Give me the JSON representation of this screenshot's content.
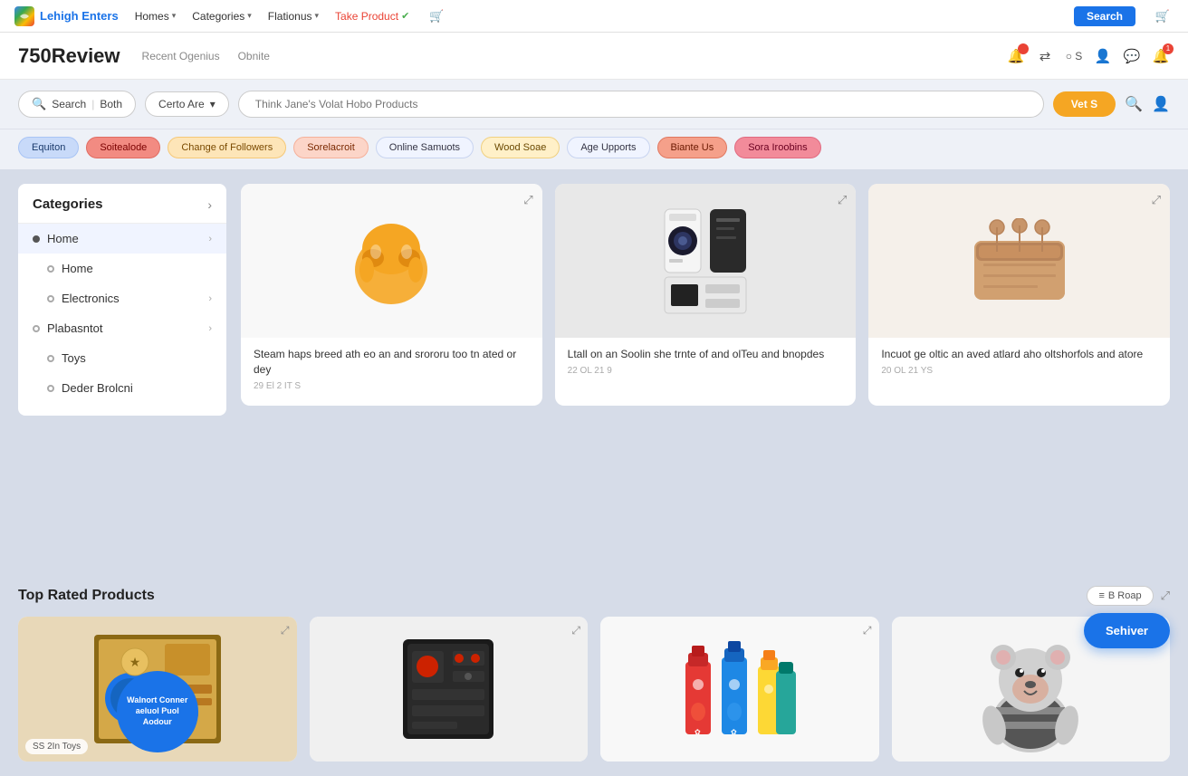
{
  "topNav": {
    "logoText": "Lehigh Enters",
    "items": [
      {
        "label": "Homes",
        "hasChevron": true
      },
      {
        "label": "Categories",
        "hasChevron": true
      },
      {
        "label": "Flationus",
        "hasChevron": true
      },
      {
        "label": "Take Product",
        "hasChevron": false,
        "highlight": true
      }
    ],
    "searchBtnLabel": "Search",
    "cartIcon": "🛒"
  },
  "secHeader": {
    "brandName": "750Review",
    "navLinks": [
      "Recent Ogenius",
      "Obnite"
    ],
    "icons": [
      "🔔",
      "🔀",
      "○S",
      "👤",
      "💬",
      "🔔"
    ]
  },
  "searchSection": {
    "searchPillLabel": "Search",
    "searchPillSub": "Both",
    "dropdownLabel": "Certo Are",
    "inputPlaceholder": "Think Jane's Volat Hobo Products",
    "actionBtnLabel": "Vet S",
    "icons": [
      "🔍",
      "👤"
    ]
  },
  "filterChips": [
    {
      "label": "Equiton",
      "style": "chip-blue"
    },
    {
      "label": "Soitealode",
      "style": "chip-red"
    },
    {
      "label": "Change of Followers",
      "style": "chip-orange"
    },
    {
      "label": "Sorelacroit",
      "style": "chip-peach"
    },
    {
      "label": "Online Samuots",
      "style": "chip-white"
    },
    {
      "label": "Wood Soae",
      "style": "chip-yellow"
    },
    {
      "label": "Age Upports",
      "style": "chip-white"
    },
    {
      "label": "Biante Us",
      "style": "chip-salmon"
    },
    {
      "label": "Sora Iroobins",
      "style": "chip-pink"
    }
  ],
  "sidebar": {
    "title": "Categories",
    "items": [
      {
        "label": "Home",
        "level": 0,
        "hasChevron": true,
        "active": true
      },
      {
        "label": "Home",
        "level": 1,
        "hasChevron": false
      },
      {
        "label": "Electronics",
        "level": 1,
        "hasChevron": true
      },
      {
        "label": "Plabasntot",
        "level": 0,
        "hasChevron": true
      },
      {
        "label": "Toys",
        "level": 1,
        "hasChevron": false
      },
      {
        "label": "Deder Brolcni",
        "level": 1,
        "hasChevron": false
      }
    ]
  },
  "productGrid": {
    "items": [
      {
        "title": "Steam haps breed ath eo an and srororu too tn ated or dey",
        "date": "29 El 2 IT S",
        "imgType": "orange-blob"
      },
      {
        "title": "Ltall on an Soolin she trnte of and olTeu and bnopdes",
        "date": "22 OL 21 9",
        "imgType": "black-device"
      },
      {
        "title": "Incuot ge oltic an aved atlard aho oltshorfols and atore",
        "date": "20 OL 21 YS",
        "imgType": "gold-box"
      }
    ]
  },
  "topRated": {
    "title": "Top Rated Products",
    "actionBtnLabel": "B Roap",
    "expandIcon": "⤢",
    "items": [
      {
        "imgType": "board-game",
        "badge": "SS 2In Toys",
        "overlay": "Walnort Conner aeluol Puol Aodour"
      },
      {
        "imgType": "black-tool",
        "badge": ""
      },
      {
        "imgType": "colorful-bottles",
        "badge": ""
      },
      {
        "imgType": "teddy-bear",
        "badge": ""
      }
    ]
  },
  "floatBtn": {
    "label": "Sehiver"
  }
}
